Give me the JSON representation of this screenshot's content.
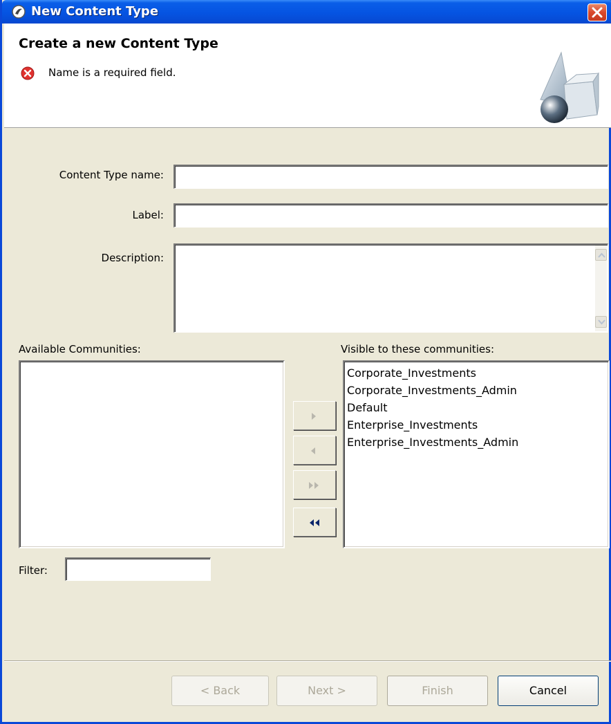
{
  "window": {
    "title": "New Content Type"
  },
  "header": {
    "title": "Create a new Content Type",
    "message": "Name is a required field."
  },
  "form": {
    "name_label": "Content Type name:",
    "name_value": "",
    "label_label": "Label:",
    "label_value": "",
    "description_label": "Description:",
    "description_value": ""
  },
  "communities": {
    "available_label": "Available Communities:",
    "available_items": [],
    "visible_label": "Visible to these communities:",
    "visible_items": [
      "Corporate_Investments",
      "Corporate_Investments_Admin",
      "Default",
      "Enterprise_Investments",
      "Enterprise_Investments_Admin"
    ],
    "filter_label": "Filter:",
    "filter_value": ""
  },
  "buttons": {
    "back": "< Back",
    "next": "Next >",
    "finish": "Finish",
    "cancel": "Cancel"
  }
}
